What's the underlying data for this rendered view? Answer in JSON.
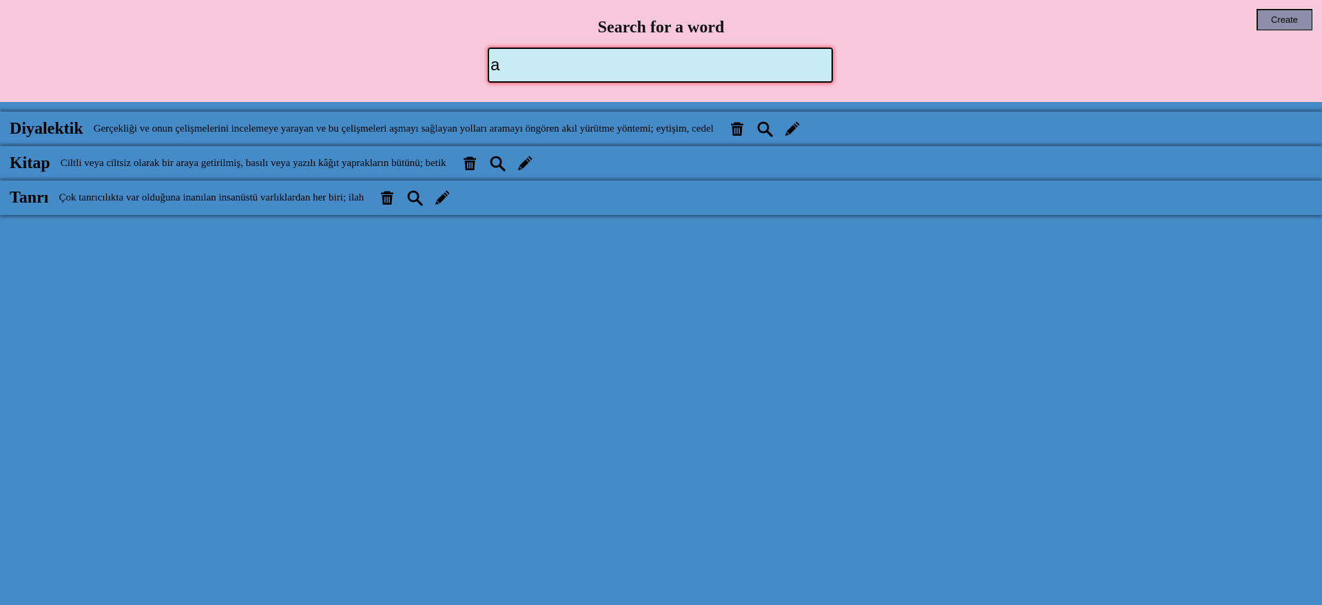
{
  "header": {
    "title": "Search for a word",
    "search_value": "a",
    "create_label": "Create"
  },
  "colors": {
    "header_bg": "#f6c8da",
    "body_bg": "#458bc8",
    "search_bg": "#c9ebf5",
    "search_glow": "#ff6f86",
    "create_bg": "#8d8ea9"
  },
  "words": [
    {
      "word": "Diyalektik",
      "definition": "Gerçekliği ve onun çelişmelerini incelemeye yarayan ve bu çelişmeleri aşmayı sağlayan yolları aramayı öngören akıl yürütme yöntemi; eytişim, cedel",
      "icons": [
        "trash-icon",
        "search-icon",
        "pencil-icon"
      ]
    },
    {
      "word": "Kitap",
      "definition": "Ciltli veya ciltsiz olarak bir araya getirilmiş, basılı veya yazılı kâğıt yaprakların bütünü; betik",
      "icons": [
        "trash-icon",
        "search-icon",
        "pencil-icon"
      ]
    },
    {
      "word": "Tanrı",
      "definition": "Çok tanrıcılıkta var olduğuna inanılan insanüstü varlıklardan her biri; ilah",
      "icons": [
        "trash-icon",
        "search-icon",
        "pencil-icon"
      ]
    }
  ]
}
